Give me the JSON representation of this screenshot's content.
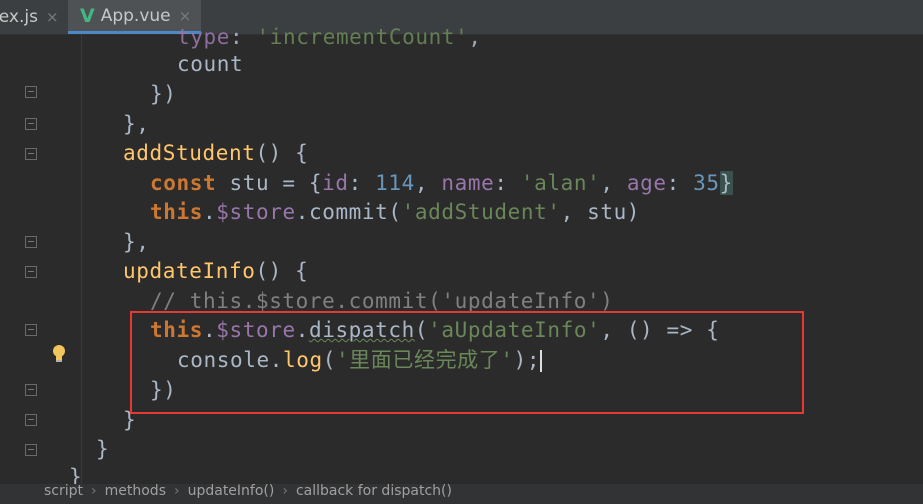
{
  "tabs": [
    {
      "label": "lex.js",
      "close": "×"
    },
    {
      "label": "App.vue",
      "close": "×",
      "icon": "V"
    }
  ],
  "code": {
    "line0": {
      "a": "type",
      "b": ": ",
      "c": "'incrementCount'",
      "d": ","
    },
    "line1": "count",
    "line2": "})",
    "line3": "},",
    "line4": {
      "fn": "addStudent",
      "rest": "() {"
    },
    "line5": {
      "kw": "const",
      "a": " stu = {",
      "p1": "id",
      "b": ": ",
      "n1": "114",
      "c": ", ",
      "p2": "name",
      "d": ": ",
      "s1": "'alan'",
      "e": ", ",
      "p3": "age",
      "f": ": ",
      "n2": "35",
      "g": "}"
    },
    "line6": {
      "kw": "this",
      "a": ".",
      "p": "$store",
      "b": ".",
      "m": "commit",
      "c": "(",
      "s": "'addStudent'",
      "d": ", stu)"
    },
    "line7": "},",
    "line8": {
      "fn": "updateInfo",
      "rest": "() {"
    },
    "line9": "// this.$store.commit('updateInfo')",
    "line10": {
      "kw": "this",
      "a": ".",
      "p": "$store",
      "b": ".",
      "m": "dispatch",
      "c": "(",
      "s": "'aUpdateInfo'",
      "d": ", () => {"
    },
    "line11": {
      "a": "console",
      "b": ".",
      "m": "log",
      "c": "(",
      "s": "'里面已经完成了'",
      "d": ");"
    },
    "line12": "})",
    "line13": "}",
    "line14": "}",
    "line15": "}"
  },
  "breadcrumb": [
    "script",
    "methods",
    "updateInfo()",
    "callback for dispatch()"
  ],
  "colors": {
    "highlight_box": "#e53935",
    "keyword": "#cc7832",
    "string": "#6a8759",
    "number": "#6897bb",
    "property": "#9876aa",
    "function": "#ffc66d"
  },
  "icons": {
    "file_icon": "vue-icon",
    "gutter": "lightbulb-icon"
  }
}
